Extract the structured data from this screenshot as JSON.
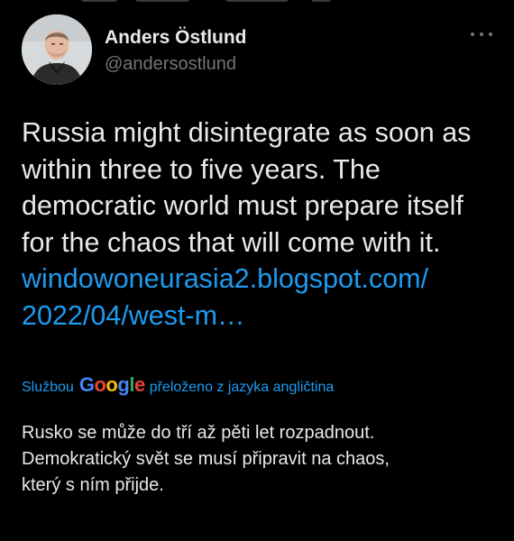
{
  "author": {
    "name": "Anders Östlund",
    "handle": "@andersostlund"
  },
  "tweet": {
    "lines": [
      "Russia might disintegrate as soon as",
      "within three to five years. The",
      "democratic world must prepare itself",
      "for the chaos that will come with it."
    ],
    "link_lines": [
      "windowoneurasia2.blogspot.com/",
      "2022/04/west-m…"
    ]
  },
  "translation": {
    "prefix": "Službou",
    "google": [
      "G",
      "o",
      "o",
      "g",
      "l",
      "e"
    ],
    "suffix": "přeloženo z jazyka angličtina",
    "lines": [
      "Rusko se může do tří až pěti let rozpadnout.",
      "Demokratický svět se musí připravit na chaos,",
      "který s ním přijde."
    ]
  },
  "colors": {
    "background": "#000000",
    "text": "#e7e9ea",
    "secondary": "#71767b",
    "link": "#1d9bf0"
  },
  "icons": {
    "more": "more-horizontal-icon"
  }
}
